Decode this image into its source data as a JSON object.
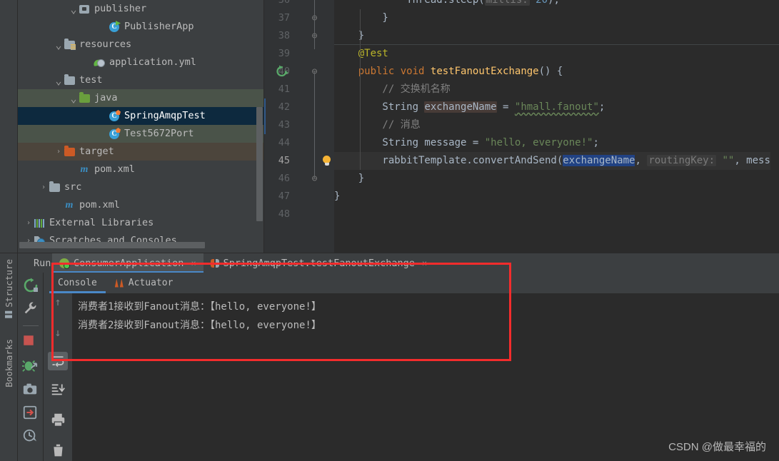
{
  "project_tree": {
    "name": "Project tool window",
    "items": [
      {
        "indent": 3,
        "arrow": "chevron-down",
        "icon": "package-icon",
        "label": "publisher",
        "state": "normal"
      },
      {
        "indent": 5,
        "arrow": "",
        "icon": "spring-class-icon",
        "label": "PublisherApp",
        "state": "normal"
      },
      {
        "indent": 2,
        "arrow": "chevron-down",
        "icon": "resources-folder-icon",
        "label": "resources",
        "state": "normal"
      },
      {
        "indent": 4,
        "arrow": "",
        "icon": "yaml-file-icon",
        "label": "application.yml",
        "state": "normal"
      },
      {
        "indent": 2,
        "arrow": "chevron-down",
        "icon": "folder-icon",
        "label": "test",
        "state": "normal"
      },
      {
        "indent": 3,
        "arrow": "chevron-down",
        "icon": "test-source-folder-icon",
        "label": "java",
        "state": "test-root"
      },
      {
        "indent": 5,
        "arrow": "",
        "icon": "test-class-icon",
        "label": "SpringAmqpTest",
        "state": "selected"
      },
      {
        "indent": 5,
        "arrow": "",
        "icon": "test-class-icon",
        "label": "Test5672Port",
        "state": "test-root"
      },
      {
        "indent": 2,
        "arrow": "chevron-right",
        "icon": "excluded-folder-icon",
        "label": "target",
        "state": "excluded"
      },
      {
        "indent": 3,
        "arrow": "",
        "icon": "maven-icon",
        "label": "pom.xml",
        "state": "normal"
      },
      {
        "indent": 1,
        "arrow": "chevron-right",
        "icon": "folder-icon",
        "label": "src",
        "state": "normal"
      },
      {
        "indent": 2,
        "arrow": "",
        "icon": "maven-icon",
        "label": "pom.xml",
        "state": "normal"
      },
      {
        "indent": 0,
        "arrow": "chevron-right",
        "icon": "external-libraries-icon",
        "label": "External Libraries",
        "state": "normal"
      },
      {
        "indent": 0,
        "arrow": "chevron-right",
        "icon": "scratches-icon",
        "label": "Scratches and Consoles",
        "state": "normal"
      }
    ]
  },
  "editor": {
    "name": "code-editor",
    "first_line_number": 36,
    "current_line": 45,
    "lines": [
      {
        "num": 36,
        "clipped": true,
        "fold": "",
        "runmark": false,
        "bulb": false,
        "tokens": [
          {
            "t": "            Thread.sleep(",
            "c": "id"
          },
          {
            "t": "millis:",
            "c": "hint"
          },
          {
            "t": " 20",
            "c": "num"
          },
          {
            "t": ");",
            "c": "id"
          }
        ]
      },
      {
        "num": 37,
        "clipped": false,
        "fold": "minus",
        "runmark": false,
        "bulb": false,
        "tokens": [
          {
            "t": "        }",
            "c": "id"
          }
        ]
      },
      {
        "num": 38,
        "clipped": false,
        "fold": "minus",
        "runmark": false,
        "bulb": false,
        "tokens": [
          {
            "t": "    }",
            "c": "id"
          }
        ]
      },
      {
        "num": 39,
        "clipped": false,
        "fold": "",
        "runmark": false,
        "bulb": false,
        "tokens": [
          {
            "t": "    @Test",
            "c": "ann"
          }
        ]
      },
      {
        "num": 40,
        "clipped": false,
        "fold": "minus",
        "runmark": true,
        "bulb": false,
        "tokens": [
          {
            "t": "    ",
            "c": "id"
          },
          {
            "t": "public",
            "c": "kw"
          },
          {
            "t": " ",
            "c": "id"
          },
          {
            "t": "void",
            "c": "kw"
          },
          {
            "t": " ",
            "c": "id"
          },
          {
            "t": "testFanoutExchange",
            "c": "mth"
          },
          {
            "t": "() {",
            "c": "id"
          }
        ]
      },
      {
        "num": 41,
        "clipped": false,
        "fold": "",
        "runmark": false,
        "bulb": false,
        "tokens": [
          {
            "t": "        // 交换机名称",
            "c": "cmt"
          }
        ]
      },
      {
        "num": 42,
        "clipped": false,
        "fold": "",
        "runmark": false,
        "bulb": false,
        "tokens": [
          {
            "t": "        String ",
            "c": "id"
          },
          {
            "t": "exchangeName",
            "c": "ident-hl"
          },
          {
            "t": " = ",
            "c": "id"
          },
          {
            "t": "\"hmall.fanout\"",
            "c": "str typo"
          },
          {
            "t": ";",
            "c": "id"
          }
        ]
      },
      {
        "num": 43,
        "clipped": false,
        "fold": "",
        "runmark": false,
        "bulb": false,
        "tokens": [
          {
            "t": "        // 消息",
            "c": "cmt"
          }
        ]
      },
      {
        "num": 44,
        "clipped": false,
        "fold": "",
        "runmark": false,
        "bulb": false,
        "tokens": [
          {
            "t": "        String message = ",
            "c": "id"
          },
          {
            "t": "\"hello, everyone!\"",
            "c": "str"
          },
          {
            "t": ";",
            "c": "id"
          }
        ]
      },
      {
        "num": 45,
        "clipped": false,
        "fold": "",
        "runmark": false,
        "bulb": true,
        "highlight": true,
        "tokens": [
          {
            "t": "        rabbitTemplate.convertAndSend(",
            "c": "id"
          },
          {
            "t": "exchangeName",
            "c": "sel"
          },
          {
            "t": ", ",
            "c": "id"
          },
          {
            "t": "routingKey:",
            "c": "hint"
          },
          {
            "t": " ",
            "c": "id"
          },
          {
            "t": "\"\"",
            "c": "str"
          },
          {
            "t": ", messa",
            "c": "id"
          }
        ]
      },
      {
        "num": 46,
        "clipped": false,
        "fold": "minus",
        "runmark": false,
        "bulb": false,
        "tokens": [
          {
            "t": "    }",
            "c": "id"
          }
        ]
      },
      {
        "num": 47,
        "clipped": false,
        "fold": "",
        "runmark": false,
        "bulb": false,
        "tokens": [
          {
            "t": "}",
            "c": "id"
          }
        ]
      },
      {
        "num": 48,
        "clipped": false,
        "fold": "",
        "runmark": false,
        "bulb": false,
        "tokens": []
      }
    ]
  },
  "run_panel": {
    "label": "Run:",
    "tabs": [
      {
        "icon": "spring-run-icon",
        "label": "ConsumerApplication",
        "close": "×",
        "active": true
      },
      {
        "icon": "junit-icon",
        "label": "SpringAmqpTest.testFanoutExchange",
        "close": "×",
        "active": false
      }
    ],
    "toolbar_buttons": [
      {
        "name": "rerun-button",
        "icon": "rerun-icon"
      },
      {
        "name": "settings-button",
        "icon": "wrench-icon"
      },
      {
        "name": "stop-button",
        "icon": "stop-square-icon"
      },
      {
        "name": "debug-attach-button",
        "icon": "debug-bug-icon"
      },
      {
        "name": "screenshot-button",
        "icon": "camera-icon"
      },
      {
        "name": "export-button",
        "icon": "export-arrow-icon"
      },
      {
        "name": "history-button",
        "icon": "clock-history-icon"
      }
    ],
    "console_tabs": [
      {
        "icon": "console-icon",
        "label": "Console",
        "active": true
      },
      {
        "icon": "actuator-icon",
        "label": "Actuator",
        "active": false
      }
    ],
    "console_side_buttons": [
      {
        "name": "scroll-up-button",
        "icon": "arrow-up-icon"
      },
      {
        "name": "scroll-down-button",
        "icon": "arrow-down-icon"
      },
      {
        "name": "soft-wrap-button",
        "icon": "soft-wrap-icon",
        "active": true
      },
      {
        "name": "scroll-to-end-button",
        "icon": "scroll-to-end-icon"
      },
      {
        "name": "print-button",
        "icon": "print-icon"
      },
      {
        "name": "clear-all-button",
        "icon": "trash-icon"
      }
    ],
    "console_output": [
      "消费者1接收到Fanout消息：【hello, everyone!】",
      "消费者2接收到Fanout消息：【hello, everyone!】"
    ]
  },
  "side_tool_tabs": [
    {
      "label": "Structure",
      "icon": "structure-icon"
    },
    {
      "label": "Bookmarks",
      "icon": "bookmarks-icon"
    }
  ],
  "annotation": {
    "name": "red-highlight-rectangle",
    "color": "#f42c2c"
  },
  "watermark": {
    "text": "CSDN @做最幸福的"
  },
  "colors": {
    "background": "#3c3f41",
    "editor_background": "#2b2b2b",
    "gutter": "#313335",
    "selection": "#214283",
    "tree_selected": "#0d293e",
    "test_root": "#4a5349",
    "excluded": "#4c453c",
    "accent_blue": "#4a88c7",
    "annotation_red": "#f42c2c"
  }
}
